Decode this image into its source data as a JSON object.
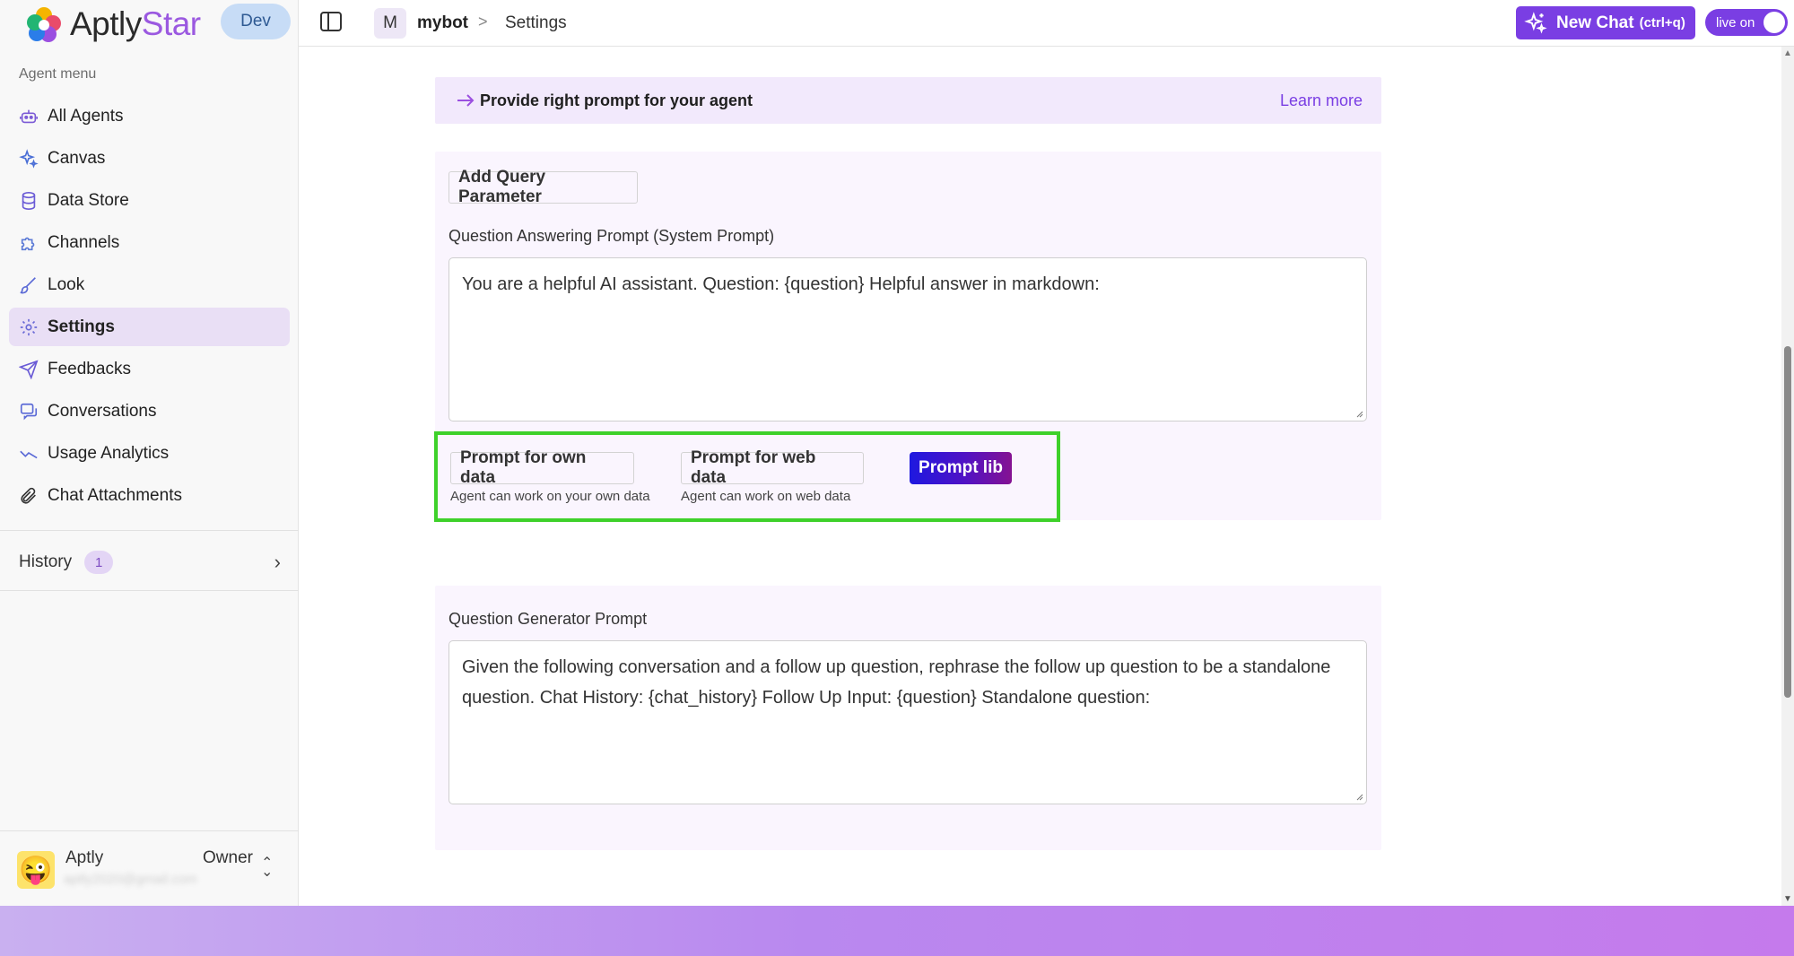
{
  "brand": {
    "name_prefix": "Aptly",
    "name_suffix": "Star",
    "env_label": "Dev"
  },
  "sidebar": {
    "section_label": "Agent menu",
    "items": [
      {
        "label": "All Agents",
        "icon": "robot-icon",
        "active": false
      },
      {
        "label": "Canvas",
        "icon": "sparkles-icon",
        "active": false
      },
      {
        "label": "Data Store",
        "icon": "database-icon",
        "active": false
      },
      {
        "label": "Channels",
        "icon": "puzzle-icon",
        "active": false
      },
      {
        "label": "Look",
        "icon": "brush-icon",
        "active": false
      },
      {
        "label": "Settings",
        "icon": "gear-icon",
        "active": true
      },
      {
        "label": "Feedbacks",
        "icon": "send-icon",
        "active": false
      },
      {
        "label": "Conversations",
        "icon": "chat-icon",
        "active": false
      },
      {
        "label": "Usage Analytics",
        "icon": "trend-icon",
        "active": false
      },
      {
        "label": "Chat Attachments",
        "icon": "paperclip-icon",
        "active": false
      }
    ],
    "history": {
      "label": "History",
      "count": "1"
    },
    "user": {
      "name": "Aptly",
      "role": "Owner",
      "email": "aptly2020@gmail.com"
    }
  },
  "topbar": {
    "breadcrumb_badge": "M",
    "bot_name": "mybot",
    "separator": ">",
    "page": "Settings",
    "new_chat_label": "New Chat",
    "new_chat_shortcut": "(ctrl+q)",
    "live_label": "live on"
  },
  "banner": {
    "text": "Provide right prompt for your agent",
    "link": "Learn more"
  },
  "qa_card": {
    "add_param_label": "Add Query Parameter",
    "field_label": "Question Answering Prompt (System Prompt)",
    "value": "You are a helpful AI assistant.  Question: {question} Helpful answer in markdown:"
  },
  "prompt_options": {
    "own": {
      "label": "Prompt for own data",
      "caption": "Agent can work on your own data"
    },
    "web": {
      "label": "Prompt for web data",
      "caption": "Agent can work on web data"
    },
    "lib_label": "Prompt lib"
  },
  "qg_card": {
    "field_label": "Question Generator Prompt",
    "value": "Given the following conversation and a follow up question, rephrase the follow up question to be a standalone question.   Chat History: {chat_history} Follow Up Input: {question} Standalone question:"
  },
  "colors": {
    "accent": "#7a3ee3",
    "active_bg": "#e9dff5",
    "card_bg": "#faf5fe",
    "highlight": "#3ed12a"
  }
}
